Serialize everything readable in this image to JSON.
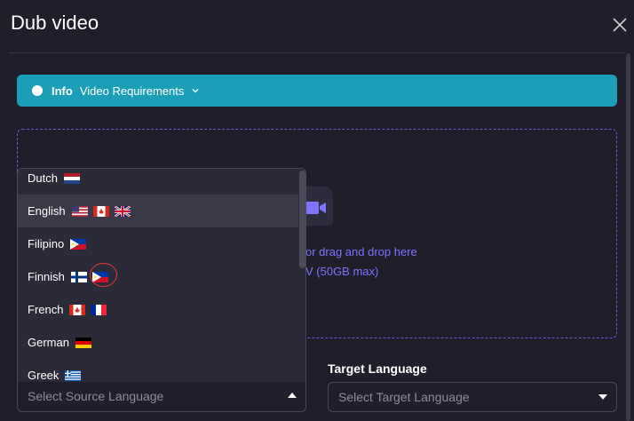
{
  "dialog": {
    "title": "Dub video",
    "close_icon": "close-icon"
  },
  "info_bar": {
    "label": "Info",
    "text": "Video Requirements",
    "color": "#1b9fb8"
  },
  "dropzone": {
    "line1_visible": "or drag and drop here",
    "line2_visible": "V (50GB max)",
    "icon": "video-camera-icon"
  },
  "source_language": {
    "placeholder": "Select Source Language",
    "options": [
      {
        "label": "Dutch",
        "flags": [
          "nl"
        ]
      },
      {
        "label": "English",
        "flags": [
          "us",
          "ca",
          "gb"
        ],
        "highlighted": true
      },
      {
        "label": "Filipino",
        "flags": [
          "ph"
        ]
      },
      {
        "label": "Finnish",
        "flags": [
          "fi",
          "ph"
        ]
      },
      {
        "label": "French",
        "flags": [
          "ca",
          "fr"
        ]
      },
      {
        "label": "German",
        "flags": [
          "de"
        ]
      },
      {
        "label": "Greek",
        "flags": [
          "gr"
        ]
      }
    ]
  },
  "target_language": {
    "label": "Target Language",
    "placeholder": "Select Target Language"
  },
  "colors": {
    "background": "#1f1e2a",
    "accent": "#7f73ff",
    "annotation": "#e53935"
  }
}
